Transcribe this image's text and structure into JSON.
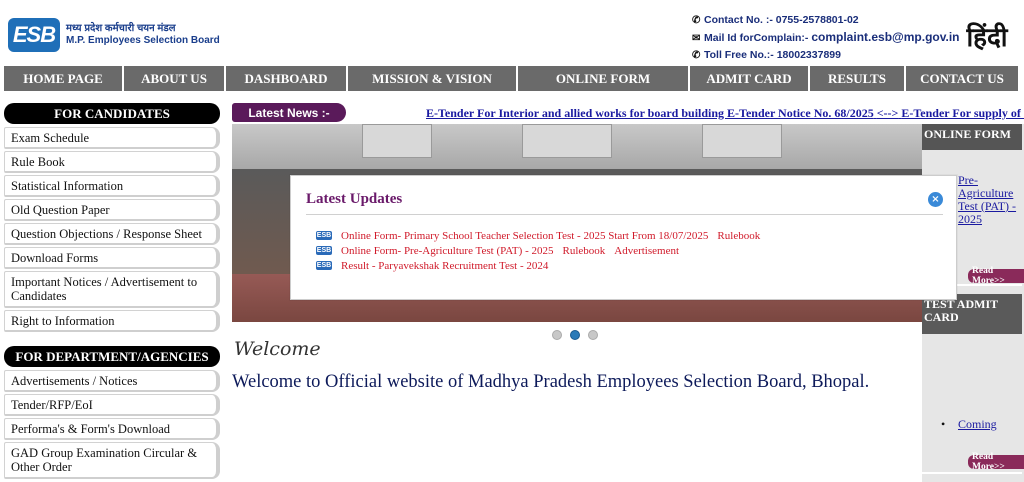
{
  "header": {
    "logo_badge": "ESB",
    "logo_hindi": "मध्य प्रदेश कर्मचारी चयन मंडल",
    "logo_english": "M.P. Employees Selection Board",
    "contact_label": "Contact No. :- 0755-2578801-02",
    "mail_label": "Mail Id forComplain:-",
    "mail_value": "complaint.esb@mp.gov.in",
    "tollfree_label": "Toll Free No.:- 18002337899",
    "hindi_button": "हिंदी"
  },
  "nav": [
    {
      "label": "HOME PAGE",
      "w": 120
    },
    {
      "label": "ABOUT US",
      "w": 102
    },
    {
      "label": "DASHBOARD",
      "w": 122
    },
    {
      "label": "MISSION & VISION",
      "w": 170
    },
    {
      "label": "ONLINE FORM",
      "w": 172
    },
    {
      "label": "ADMIT CARD",
      "w": 120
    },
    {
      "label": "RESULTS",
      "w": 96
    },
    {
      "label": "CONTACT US",
      "w": 112
    }
  ],
  "sidebar": {
    "candidates_heading": "FOR CANDIDATES",
    "candidates_items": [
      "Exam Schedule",
      "Rule Book",
      "Statistical Information",
      "Old Question Paper",
      "Question Objections / Response Sheet",
      "Download Forms",
      "Important Notices / Advertisement to Candidates",
      "Right to Information"
    ],
    "department_heading": "FOR DEPARTMENT/AGENCIES",
    "department_items": [
      "Advertisements / Notices",
      "Tender/RFP/EoI",
      "Performa's & Form's Download",
      "GAD Group Examination Circular & Other Order"
    ]
  },
  "ticker": {
    "label": "Latest News :-",
    "item1": "E-Tender For Interior and allied works for board building E-Tender Notice No. 68/2025",
    "separator": "<-->",
    "item2": "E-Tender For supply of cleaning mat"
  },
  "welcome": {
    "script": "Welcome",
    "text": "Welcome to Official website of Madhya Pradesh Employees Selection Board, Bhopal."
  },
  "right_column": {
    "online_form_heading": "ONLINE FORM",
    "online_form_link": "Pre-Agriculture Test (PAT) - 2025",
    "read_more": "Read More>>",
    "admit_card_heading": "TEST ADMIT CARD",
    "admit_card_link": "Coming"
  },
  "modal": {
    "title": "Latest Updates",
    "close_glyph": "×",
    "icon_text": "ESB",
    "updates": [
      {
        "text": "Online Form- Primary School Teacher Selection Test - 2025 Start From 18/07/2025",
        "links": [
          "Rulebook"
        ]
      },
      {
        "text": "Online Form- Pre-Agriculture Test (PAT) - 2025",
        "links": [
          "Rulebook",
          "Advertisement"
        ]
      },
      {
        "text": "Result - Paryavekshak Recruitment Test - 2024",
        "links": []
      }
    ]
  },
  "carousel": {
    "slides": 3,
    "active_slide": 2
  },
  "colors": {
    "nav_bg": "#6a6a6a",
    "ticker_label_bg": "#5a1a5a",
    "modal_title": "#6a1a6a",
    "update_link": "#d01a2a",
    "read_more_bg": "#8a2a5a"
  }
}
